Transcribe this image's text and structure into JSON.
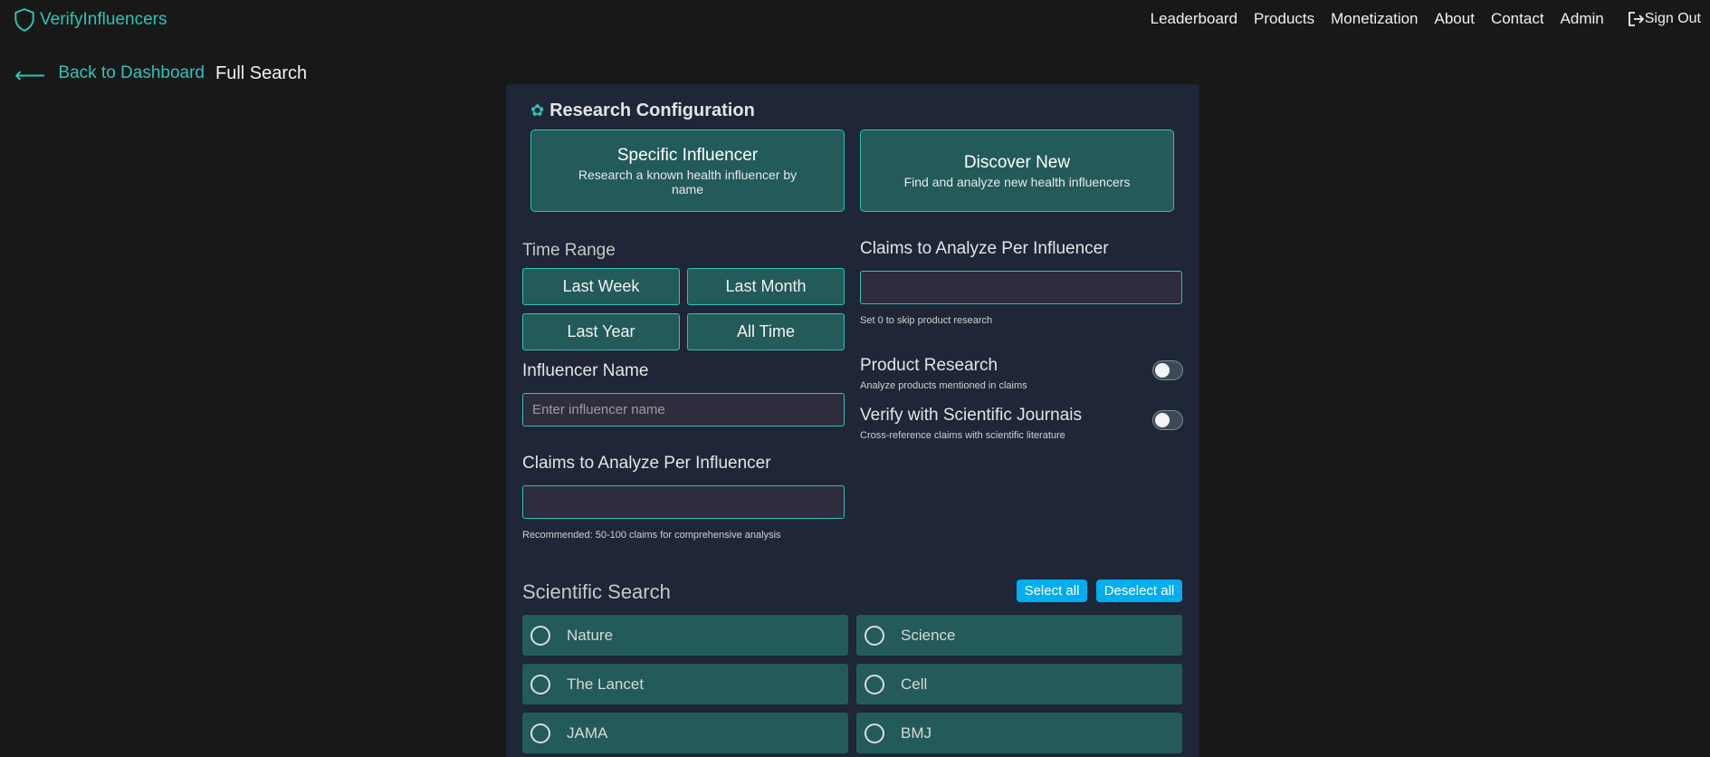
{
  "brand": {
    "name": "VerifyInfluencers",
    "logo_icon": "shield-icon"
  },
  "nav": {
    "links": [
      "Leaderboard",
      "Products",
      "Monetization",
      "About",
      "Contact",
      "Admin"
    ],
    "signout_label": "Sign Out",
    "signout_icon": "logout-icon"
  },
  "subheader": {
    "back_icon": "arrow-left-icon",
    "back_label": "Back to Dashboard",
    "page_title": "Full Search"
  },
  "panel": {
    "title": "Research Configuration",
    "title_icon": "gear-icon",
    "modes": [
      {
        "title": "Specific Influencer",
        "desc": "Research a known health influencer by name"
      },
      {
        "title": "Discover New",
        "desc": "Find and analyze new health influencers"
      }
    ],
    "time_range": {
      "label": "Time Range",
      "options": [
        "Last Week",
        "Last Month",
        "Last Year",
        "All Time"
      ]
    },
    "influencer_name": {
      "label": "Influencer Name",
      "placeholder": "Enter influencer name",
      "value": ""
    },
    "claims_left": {
      "label": "Claims to Analyze Per Influencer",
      "value": "",
      "hint": "Recommended: 50-100 claims for comprehensive analysis"
    },
    "claims_right": {
      "label": "Claims to Analyze Per Influencer",
      "value": "",
      "hint": "Set 0 to skip product research"
    },
    "product_research": {
      "label": "Product Research",
      "desc": "Analyze products mentioned in claims",
      "enabled": false
    },
    "verify_journals": {
      "label": "Verify with Scientific Journais",
      "desc": "Cross-reference claims with scientific literature",
      "enabled": false
    },
    "scientific_search": {
      "label": "Scientific Search",
      "select_all": "Select all",
      "deselect_all": "Deselect all",
      "journals": [
        "Nature",
        "Science",
        "The Lancet",
        "Cell",
        "JAMA",
        "BMJ"
      ]
    }
  },
  "colors": {
    "accent": "#2ec4b6",
    "card_bg": "#235a5a",
    "panel_bg": "#1e2637",
    "page_bg": "#181818",
    "action_blue": "#00aeef"
  }
}
